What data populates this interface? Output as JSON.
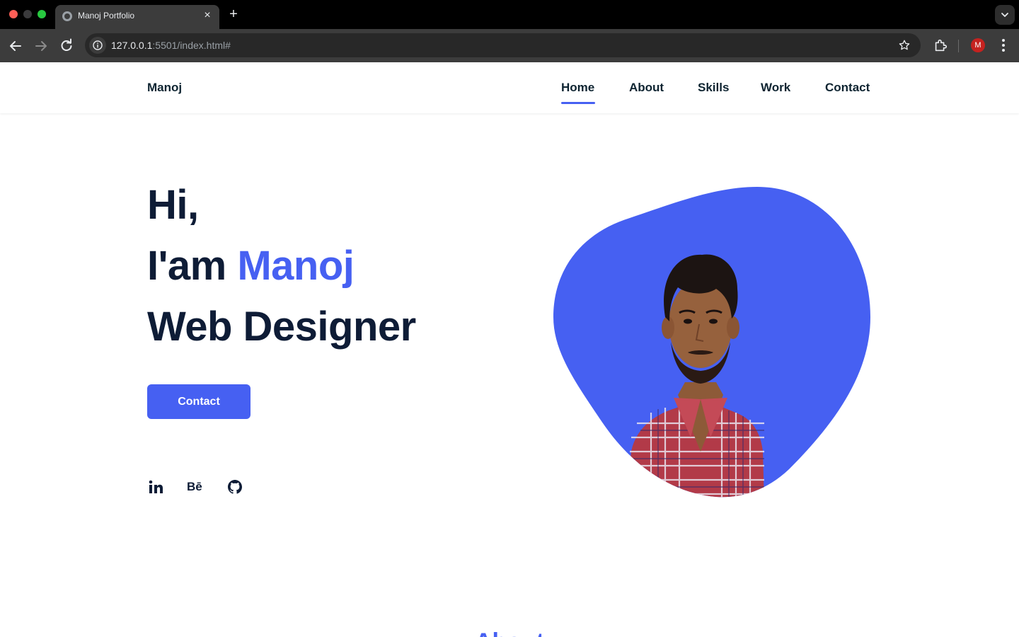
{
  "browser": {
    "tab_title": "Manoj Portfolio",
    "url_host": "127.0.0.1",
    "url_rest": ":5501/index.html#",
    "profile_initial": "M"
  },
  "site": {
    "logo": "Manoj",
    "nav": {
      "home": "Home",
      "about": "About",
      "skills": "Skills",
      "work": "Work",
      "contact": "Contact",
      "active": "Home"
    },
    "hero": {
      "line1": "Hi,",
      "line2_prefix": "I'am ",
      "line2_name": "Manoj",
      "line3": "Web Designer",
      "button_label": "Contact"
    },
    "social": {
      "behance_label": "Bē",
      "icons": [
        "linkedin-icon",
        "behance-icon",
        "github-icon"
      ]
    },
    "about_heading": "About"
  },
  "colors": {
    "accent": "#4660f2",
    "heading": "#0e1c36"
  }
}
